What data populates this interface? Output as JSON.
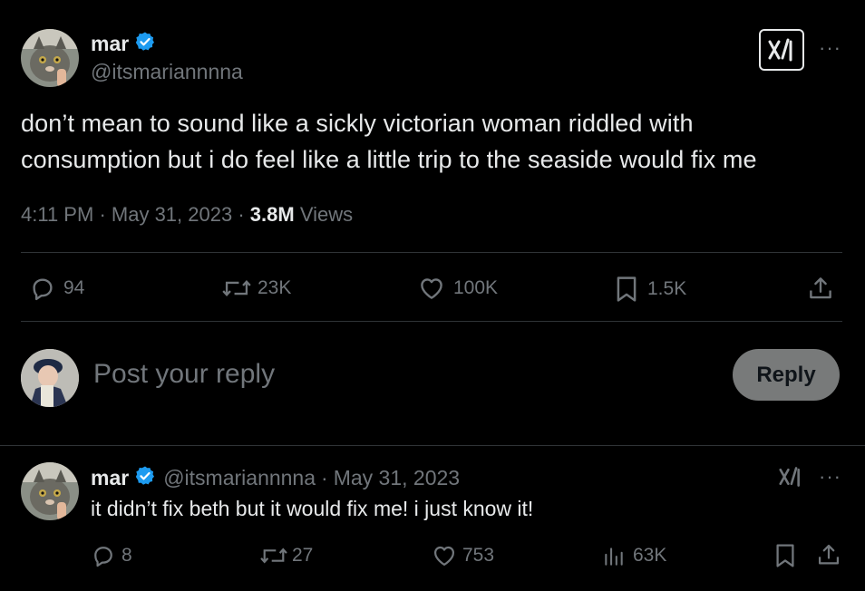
{
  "tweet": {
    "author_name": "mar",
    "author_handle": "@itsmariannnna",
    "text_line1": "don’t mean to sound like a sickly victorian woman riddled with",
    "text_line2": "consumption but i do feel like a little trip to the seaside would fix me",
    "time": "4:11 PM",
    "date": "May 31, 2023",
    "views_count": "3.8M",
    "views_label": "Views",
    "sep": "·",
    "actions": {
      "replies": "94",
      "retweets": "23K",
      "likes": "100K",
      "bookmarks": "1.5K"
    },
    "more_label": "···"
  },
  "composer": {
    "placeholder": "Post your reply",
    "reply_button": "Reply"
  },
  "reply": {
    "author_name": "mar",
    "author_handle": "@itsmariannnna",
    "sep": "·",
    "date": "May 31, 2023",
    "text": "it didn’t fix beth but it would fix me! i just know it!",
    "actions": {
      "replies": "8",
      "retweets": "27",
      "likes": "753",
      "views": "63K"
    },
    "more_label": "···"
  },
  "colors": {
    "background": "#000000",
    "text": "#e7e9ea",
    "muted": "#71767b",
    "verified": "#1d9bf0",
    "divider": "#2f3336",
    "reply_button_bg": "#787a7a"
  },
  "icons": [
    "verified-icon",
    "grok-icon",
    "more-icon",
    "reply-icon",
    "retweet-icon",
    "like-icon",
    "bookmark-icon",
    "share-icon",
    "views-icon"
  ]
}
